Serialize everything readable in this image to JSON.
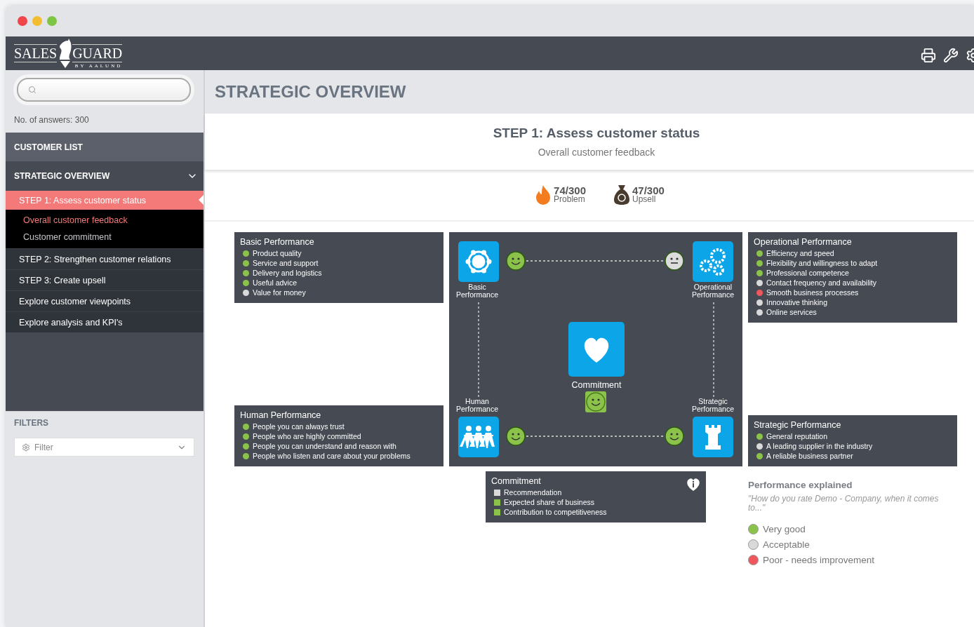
{
  "logo": {
    "left": "SALES",
    "right": "GUARD",
    "tagline": "BY AALUND"
  },
  "sidebar": {
    "answers": "No. of answers: 300",
    "nav": [
      {
        "kind": "link",
        "label": "CUSTOMER LIST"
      },
      {
        "kind": "group",
        "label": "STRATEGIC OVERVIEW",
        "expanded": true,
        "children": [
          {
            "label": "STEP 1: Assess customer status",
            "selected": true,
            "children": [
              {
                "label": "Overall customer feedback",
                "selected": true
              },
              {
                "label": "Customer commitment",
                "selected": false
              }
            ]
          },
          {
            "label": "STEP 2: Strengthen customer relations",
            "selected": false
          },
          {
            "label": "STEP 3: Create upsell",
            "selected": false
          },
          {
            "label": "Explore customer viewpoints",
            "selected": false
          },
          {
            "label": "Explore analysis and KPI's",
            "selected": false
          }
        ]
      }
    ],
    "filters": {
      "title": "FILTERS",
      "dropdown": "Filter"
    }
  },
  "main": {
    "title": "STRATEGIC OVERVIEW",
    "step": {
      "title": "STEP 1: Assess customer status",
      "subtitle": "Overall customer feedback"
    },
    "stats": [
      {
        "kind": "problem",
        "value": "74/300",
        "label": "Problem"
      },
      {
        "kind": "upsell",
        "value": "47/300",
        "label": "Upsell"
      }
    ],
    "boxes": {
      "basic": {
        "title": "Basic Performance",
        "items": [
          {
            "label": "Product quality",
            "color": "#8bc34a"
          },
          {
            "label": "Service and support",
            "color": "#8bc34a"
          },
          {
            "label": "Delivery and logistics",
            "color": "#8bc34a"
          },
          {
            "label": "Useful advice",
            "color": "#8bc34a"
          },
          {
            "label": "Value for money",
            "color": "#d9d9d9"
          }
        ]
      },
      "human": {
        "title": "Human Performance",
        "items": [
          {
            "label": "People you can always trust",
            "color": "#8bc34a"
          },
          {
            "label": "People who are highly committed",
            "color": "#8bc34a"
          },
          {
            "label": "People you can understand and reason with",
            "color": "#8bc34a"
          },
          {
            "label": "People who listen and care about your problems",
            "color": "#8bc34a"
          }
        ]
      },
      "operational": {
        "title": "Operational Performance",
        "items": [
          {
            "label": "Efficiency and speed",
            "color": "#8bc34a"
          },
          {
            "label": "Flexibility and willingness to adapt",
            "color": "#8bc34a"
          },
          {
            "label": "Professional competence",
            "color": "#8bc34a"
          },
          {
            "label": "Contact frequency and availability",
            "color": "#d9d9d9"
          },
          {
            "label": "Smooth business processes",
            "color": "#f0575c"
          },
          {
            "label": "Innovative thinking",
            "color": "#d9d9d9"
          },
          {
            "label": "Online services",
            "color": "#d9d9d9"
          }
        ]
      },
      "strategic": {
        "title": "Strategic Performance",
        "items": [
          {
            "label": "General reputation",
            "color": "#8bc34a"
          },
          {
            "label": "A leading supplier in the industry",
            "color": "#d9d9d9"
          },
          {
            "label": "A reliable business partner",
            "color": "#8bc34a"
          }
        ]
      }
    },
    "diagram": {
      "nodes": [
        {
          "kind": "basic",
          "label": "Basic Performance",
          "satisfied": true
        },
        {
          "kind": "operational",
          "label": "Operational Performance",
          "satisfied": false
        },
        {
          "kind": "human",
          "label": "Human Performance",
          "satisfied": true
        },
        {
          "kind": "strategic",
          "label": "Strategic Performance",
          "satisfied": true
        }
      ],
      "center": {
        "label": "Commitment",
        "satisfied": true
      }
    },
    "commitment": {
      "title": "Commitment",
      "items": [
        {
          "label": "Recommendation",
          "color": "#d9d9d9"
        },
        {
          "label": "Expected share of business",
          "color": "#8bc34a"
        },
        {
          "label": "Contribution to competitiveness",
          "color": "#8bc34a"
        }
      ]
    },
    "legend": {
      "title": "Performance explained",
      "question": "\"How do you rate Demo - Company, when it comes to...\"",
      "items": [
        {
          "label": "Very good",
          "color": "#8bc34a"
        },
        {
          "label": "Acceptable",
          "color": "#d9d9d9"
        },
        {
          "label": "Poor - needs improvement",
          "color": "#f0575c"
        }
      ]
    }
  }
}
